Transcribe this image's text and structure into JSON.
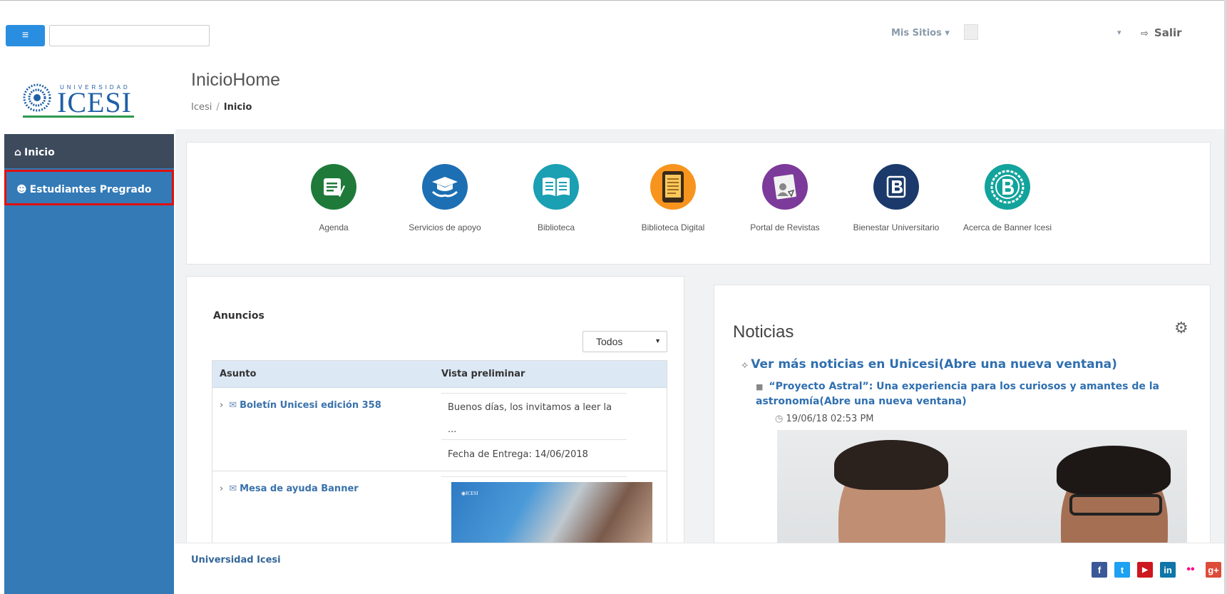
{
  "topbar": {
    "menu_icon": "hamburger-icon",
    "search_value": "",
    "mis_sitios": "Mis Sitios ▾",
    "user_caret": "▾",
    "logout_label": "Salir",
    "logout_icon": "logout-icon"
  },
  "logo": {
    "small_text": "UNIVERSIDAD",
    "big_text": "ICESI"
  },
  "page": {
    "title": "InicioHome",
    "breadcrumb_root": "Icesi",
    "breadcrumb_sep": "/",
    "breadcrumb_current": "Inicio"
  },
  "sidebar": {
    "items": [
      {
        "label": "Inicio",
        "icon": "home-icon"
      },
      {
        "label": "Estudiantes Pregrado",
        "icon": "students-icon"
      }
    ]
  },
  "apps": [
    {
      "label": "Agenda",
      "icon": "agenda-icon",
      "color": "#1f7a3a"
    },
    {
      "label": "Servicios de apoyo",
      "icon": "graduation-cap-icon",
      "color": "#1c6fb3"
    },
    {
      "label": "Biblioteca",
      "icon": "book-icon",
      "color": "#1a9fb3"
    },
    {
      "label": "Biblioteca Digital",
      "icon": "tablet-icon",
      "color": "#f7941d"
    },
    {
      "label": "Portal de Revistas",
      "icon": "journal-icon",
      "color": "#7c3a9a"
    },
    {
      "label": "Bienestar Universitario",
      "icon": "bienestar-icon",
      "color": "#1b3a6b"
    },
    {
      "label": "Acerca de Banner Icesi",
      "icon": "banner-icon",
      "color": "#12a39c"
    }
  ],
  "announcements": {
    "title": "Anuncios",
    "filter_value": "Todos",
    "col_subject": "Asunto",
    "col_preview": "Vista preliminar",
    "rows": [
      {
        "subject": "Boletín Unicesi edición 358",
        "preview": "Buenos días, los invitamos a leer la",
        "preview_more": "...",
        "due": "Fecha de Entrega: 14/06/2018"
      },
      {
        "subject": "Mesa de ayuda Banner"
      }
    ]
  },
  "news": {
    "title": "Noticias",
    "more_link": "Ver más noticias en Unicesi(Abre una nueva ventana)",
    "item_title": "“Proyecto Astral”: Una experiencia para los curiosos y amantes de la astronomía(Abre una nueva ventana)",
    "item_date": "19/06/18 02:53 PM"
  },
  "footer": {
    "org_name": "Universidad Icesi",
    "social": [
      {
        "icon": "facebook-icon",
        "glyph": "f",
        "color": "#3b5998"
      },
      {
        "icon": "twitter-icon",
        "glyph": "t",
        "color": "#1da1f2"
      },
      {
        "icon": "youtube-icon",
        "glyph": "▶",
        "color": "#cc181e"
      },
      {
        "icon": "linkedin-icon",
        "glyph": "in",
        "color": "#0e76a8"
      },
      {
        "icon": "flickr-icon",
        "glyph": "••",
        "color": "#ffffff"
      },
      {
        "icon": "googleplus-icon",
        "glyph": "g+",
        "color": "#dd4b39"
      }
    ]
  }
}
